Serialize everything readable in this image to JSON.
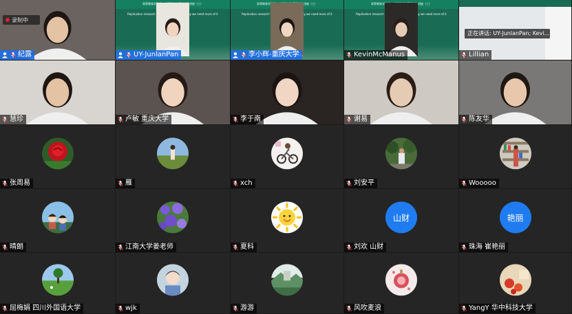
{
  "recording_label": "录制中",
  "speaking_label": "正在讲话: UY-JunlanPan; Kevi...",
  "participants": [
    {
      "name": "纪露",
      "kind": "video",
      "host": true
    },
    {
      "name": "UY-JunlanPan",
      "kind": "slide",
      "host": true
    },
    {
      "name": "李小辉-重庆大学",
      "kind": "slide",
      "host": true
    },
    {
      "name": "KevinMcManus",
      "kind": "slide"
    },
    {
      "name": "Lillian",
      "kind": "screen"
    },
    {
      "name": "慧珍",
      "kind": "video"
    },
    {
      "name": "卢敏  重庆大学",
      "kind": "video"
    },
    {
      "name": "李于南",
      "kind": "video"
    },
    {
      "name": "谢易",
      "kind": "video"
    },
    {
      "name": "陈友华",
      "kind": "video"
    },
    {
      "name": "张周易",
      "kind": "avatar",
      "avatar": "rose"
    },
    {
      "name": "雁",
      "kind": "avatar",
      "avatar": "field-girl"
    },
    {
      "name": "xch",
      "kind": "avatar",
      "avatar": "bike"
    },
    {
      "name": "刘安平",
      "kind": "avatar",
      "avatar": "man-trees"
    },
    {
      "name": "Wooooo",
      "kind": "avatar",
      "avatar": "shelves"
    },
    {
      "name": "晴朗",
      "kind": "avatar",
      "avatar": "anime"
    },
    {
      "name": "江南大学姜老师",
      "kind": "avatar",
      "avatar": "flowers"
    },
    {
      "name": "夏科",
      "kind": "avatar",
      "avatar": "sun"
    },
    {
      "name": "刘欢  山财",
      "kind": "avatar-text",
      "avatar_text": "山财"
    },
    {
      "name": "珠海 崔艳丽",
      "kind": "avatar-text",
      "avatar_text": "艳丽"
    },
    {
      "name": "屈梅娟  四川外国语大学",
      "kind": "avatar",
      "avatar": "tree-field"
    },
    {
      "name": "wjk",
      "kind": "avatar",
      "avatar": "boy"
    },
    {
      "name": "游游",
      "kind": "avatar",
      "avatar": "landscape"
    },
    {
      "name": "风吹麦浪",
      "kind": "avatar",
      "avatar": "ornament"
    },
    {
      "name": "YangY  华中科技大学",
      "kind": "avatar",
      "avatar": "red-flowers"
    }
  ],
  "slide_title": "高等教育学院四川外国语学院英语学院讲座（三）",
  "slide_subtitle": "Replication research in the field of L2 and why we need more of it",
  "colors": {
    "avatar_text_bg": "#1f7cf0",
    "slide_bg": "#1a6b53",
    "host_bar": "#1e6ee6"
  }
}
